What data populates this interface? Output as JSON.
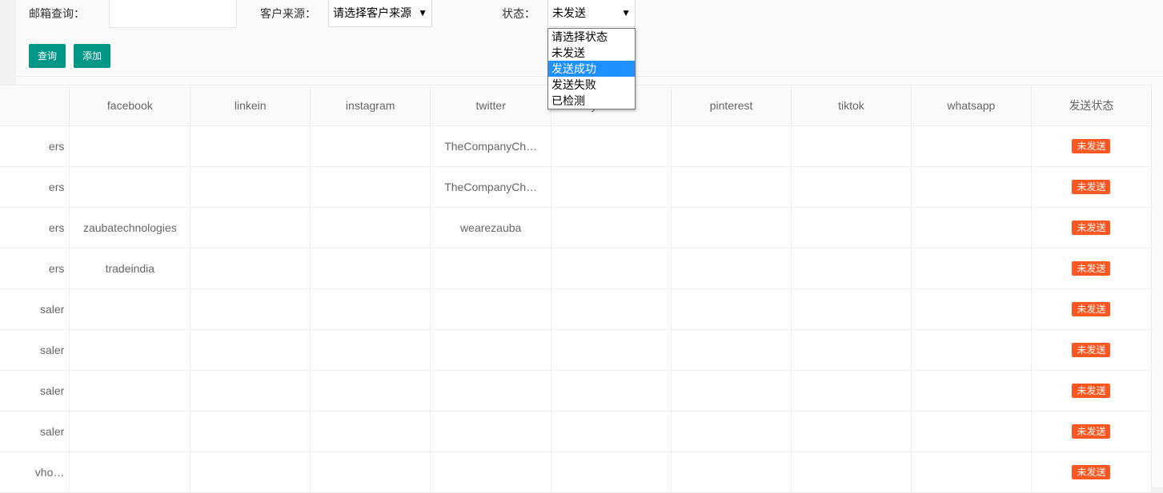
{
  "filters": {
    "email_label": "邮箱查询：",
    "email_value": "",
    "source_label": "客户来源：",
    "source_value": "请选择客户来源",
    "status_label": "状态：",
    "status_value": "未发送"
  },
  "buttons": {
    "query": "查询",
    "add": "添加"
  },
  "status_dropdown": {
    "options": [
      "请选择状态",
      "未发送",
      "发送成功",
      "发送失败",
      "已检测"
    ],
    "highlighted": "发送成功"
  },
  "table": {
    "columns": [
      "",
      "facebook",
      "linkein",
      "instagram",
      "twitter",
      "youtube",
      "pinterest",
      "tiktok",
      "whatsapp",
      "发送状态"
    ],
    "rows": [
      [
        "ers",
        "",
        "",
        "",
        "TheCompanyCh…",
        "",
        "",
        "",
        "",
        "未发送"
      ],
      [
        "ers",
        "",
        "",
        "",
        "TheCompanyCh…",
        "",
        "",
        "",
        "",
        "未发送"
      ],
      [
        "ers",
        "zaubatechnologies",
        "",
        "",
        "wearezauba",
        "",
        "",
        "",
        "",
        "未发送"
      ],
      [
        "ers",
        "tradeindia",
        "",
        "",
        "",
        "",
        "",
        "",
        "",
        "未发送"
      ],
      [
        "saler",
        "",
        "",
        "",
        "",
        "",
        "",
        "",
        "",
        "未发送"
      ],
      [
        "saler",
        "",
        "",
        "",
        "",
        "",
        "",
        "",
        "",
        "未发送"
      ],
      [
        "saler",
        "",
        "",
        "",
        "",
        "",
        "",
        "",
        "",
        "未发送"
      ],
      [
        "saler",
        "",
        "",
        "",
        "",
        "",
        "",
        "",
        "",
        "未发送"
      ],
      [
        "vho…",
        "",
        "",
        "",
        "",
        "",
        "",
        "",
        "",
        "未发送"
      ]
    ]
  },
  "colors": {
    "primary": "#009688",
    "badge": "#ff5722",
    "highlight": "#1e90ff"
  }
}
